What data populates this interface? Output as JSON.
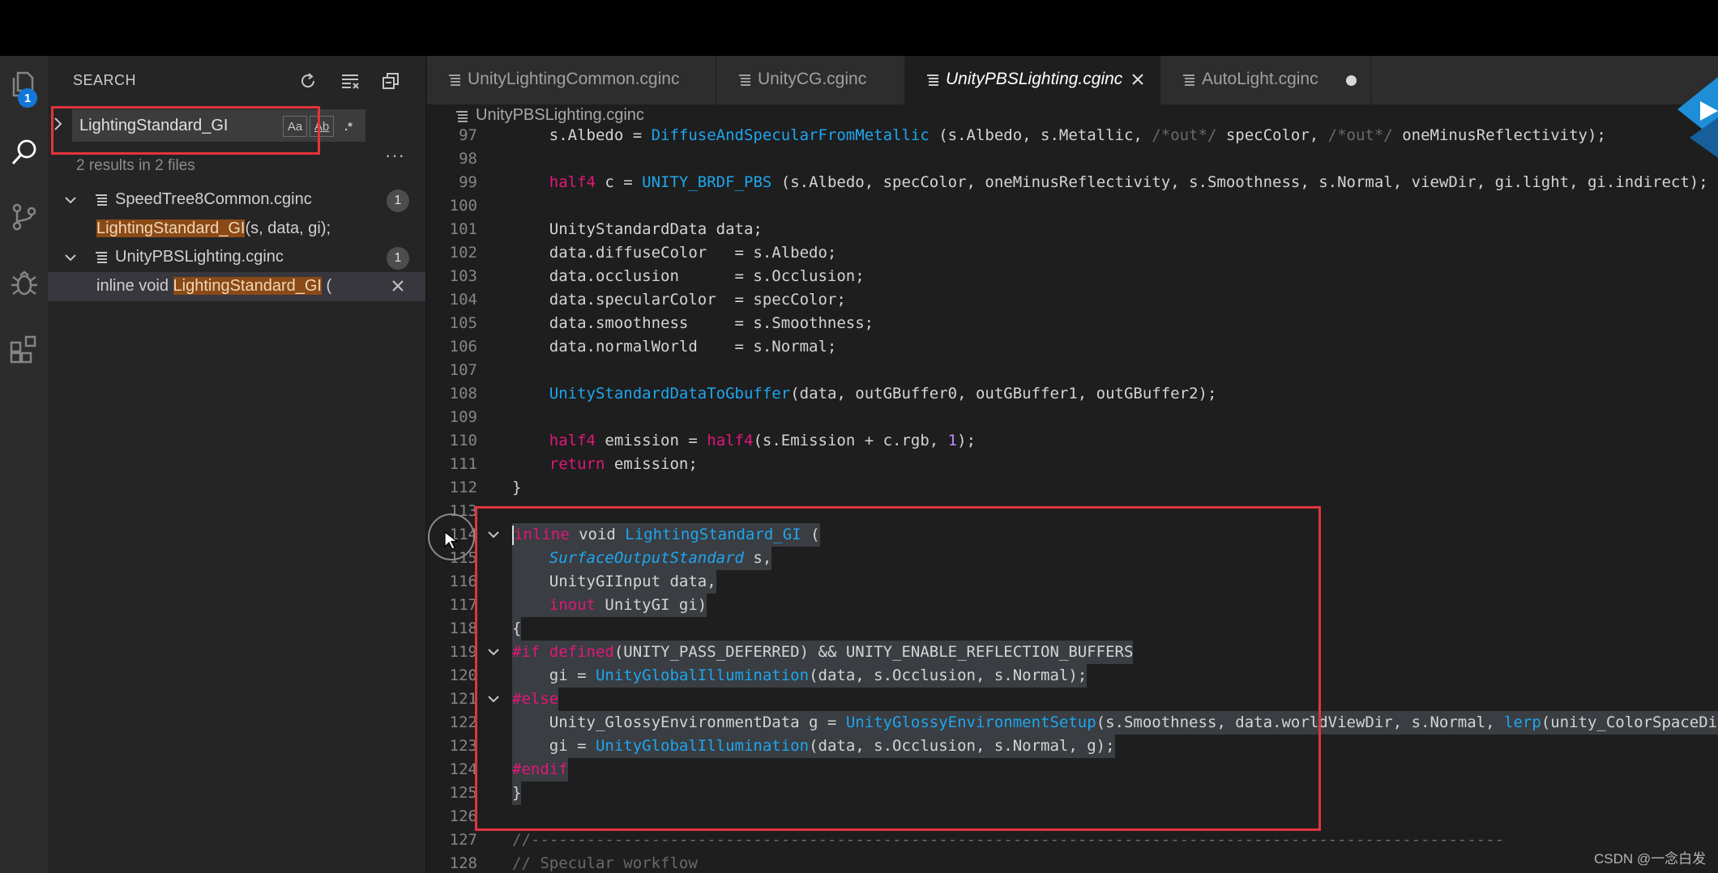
{
  "search": {
    "title": "SEARCH",
    "query": "LightingStandard_GI",
    "match_case_label": "Aa",
    "whole_word_label": "Ab",
    "regex_label": ".*",
    "more_label": "···",
    "summary": "2 results in 2 files",
    "results": [
      {
        "file": "SpeedTree8Common.cginc",
        "count": "1",
        "match": {
          "before": "",
          "hit": "LightingStandard_GI",
          "after": "(s, data, gi);"
        }
      },
      {
        "file": "UnityPBSLighting.cginc",
        "count": "1",
        "match": {
          "before": "inline void ",
          "hit": "LightingStandard_GI",
          "after": " ("
        }
      }
    ]
  },
  "activity_bar": {
    "badge": "1",
    "icons": [
      "files-icon",
      "search-icon",
      "source-control-icon",
      "debug-icon",
      "extensions-icon"
    ]
  },
  "tabs": [
    {
      "label": "UnityLightingCommon.cginc",
      "active": false
    },
    {
      "label": "UnityCG.cginc",
      "active": false
    },
    {
      "label": "UnityPBSLighting.cginc",
      "active": true
    },
    {
      "label": "AutoLight.cginc",
      "active": false,
      "modified": true
    }
  ],
  "breadcrumb": {
    "file": "UnityPBSLighting.cginc"
  },
  "code_lines": [
    {
      "n": "97",
      "segs": [
        [
          "    s.Albedo = ",
          ""
        ],
        [
          "DiffuseAndSpecularFromMetallic",
          "fn"
        ],
        [
          " (s.Albedo, s.Metallic, ",
          ""
        ],
        [
          "/*out*/",
          "cm"
        ],
        [
          " specColor, ",
          ""
        ],
        [
          "/*out*/",
          "cm"
        ],
        [
          " oneMinusReflectivity);",
          ""
        ]
      ]
    },
    {
      "n": "98",
      "segs": []
    },
    {
      "n": "99",
      "segs": [
        [
          "    ",
          ""
        ],
        [
          "half4",
          "kw"
        ],
        [
          " c = ",
          ""
        ],
        [
          "UNITY_BRDF_PBS",
          "fn"
        ],
        [
          " (s.Albedo, specColor, oneMinusReflectivity, s.Smoothness, s.Normal, viewDir, gi.light, gi.indirect);",
          ""
        ]
      ]
    },
    {
      "n": "100",
      "segs": []
    },
    {
      "n": "101",
      "segs": [
        [
          "    UnityStandardData data;",
          ""
        ]
      ]
    },
    {
      "n": "102",
      "segs": [
        [
          "    data.diffuseColor   = s.Albedo;",
          ""
        ]
      ]
    },
    {
      "n": "103",
      "segs": [
        [
          "    data.occlusion      = s.Occlusion;",
          ""
        ]
      ]
    },
    {
      "n": "104",
      "segs": [
        [
          "    data.specularColor  = specColor;",
          ""
        ]
      ]
    },
    {
      "n": "105",
      "segs": [
        [
          "    data.smoothness     = s.Smoothness;",
          ""
        ]
      ]
    },
    {
      "n": "106",
      "segs": [
        [
          "    data.normalWorld    = s.Normal;",
          ""
        ]
      ]
    },
    {
      "n": "107",
      "segs": []
    },
    {
      "n": "108",
      "segs": [
        [
          "    ",
          ""
        ],
        [
          "UnityStandardDataToGbuffer",
          "fn"
        ],
        [
          "(data, outGBuffer0, outGBuffer1, outGBuffer2);",
          ""
        ]
      ]
    },
    {
      "n": "109",
      "segs": []
    },
    {
      "n": "110",
      "segs": [
        [
          "    ",
          ""
        ],
        [
          "half4",
          "kw"
        ],
        [
          " emission = ",
          ""
        ],
        [
          "half4",
          "kw"
        ],
        [
          "(s.Emission + c.rgb, ",
          ""
        ],
        [
          "1",
          "num"
        ],
        [
          ");",
          ""
        ]
      ]
    },
    {
      "n": "111",
      "segs": [
        [
          "    ",
          ""
        ],
        [
          "return",
          "kw"
        ],
        [
          " emission;",
          ""
        ]
      ]
    },
    {
      "n": "112",
      "segs": [
        [
          "}",
          ""
        ]
      ]
    },
    {
      "n": "113",
      "segs": []
    },
    {
      "n": "114",
      "fold": true,
      "sel": true,
      "cursor": true,
      "segs": [
        [
          "inline",
          "kw"
        ],
        [
          " void ",
          ""
        ],
        [
          "LightingStandard_GI",
          "fn"
        ],
        [
          " (",
          ""
        ]
      ]
    },
    {
      "n": "115",
      "sel": true,
      "segs": [
        [
          "    ",
          ""
        ],
        [
          "SurfaceOutputStandard",
          "it"
        ],
        [
          " s,",
          ""
        ]
      ]
    },
    {
      "n": "116",
      "sel": true,
      "segs": [
        [
          "    UnityGIInput data,",
          ""
        ]
      ]
    },
    {
      "n": "117",
      "sel": true,
      "segs": [
        [
          "    ",
          ""
        ],
        [
          "inout",
          "kw"
        ],
        [
          " UnityGI gi)",
          ""
        ]
      ]
    },
    {
      "n": "118",
      "sel": true,
      "segs": [
        [
          "{",
          ""
        ]
      ]
    },
    {
      "n": "119",
      "fold": true,
      "sel": true,
      "segs": [
        [
          "#if defined",
          "kw"
        ],
        [
          "(UNITY_PASS_DEFERRED) && UNITY_ENABLE_REFLECTION_BUFFERS",
          ""
        ]
      ]
    },
    {
      "n": "120",
      "sel": true,
      "segs": [
        [
          "    gi = ",
          ""
        ],
        [
          "UnityGlobalIllumination",
          "fn"
        ],
        [
          "(data, s.Occlusion, s.Normal);",
          ""
        ]
      ]
    },
    {
      "n": "121",
      "fold": true,
      "sel": true,
      "segs": [
        [
          "#else",
          "kw"
        ]
      ]
    },
    {
      "n": "122",
      "sel": true,
      "segs": [
        [
          "    Unity_GlossyEnvironmentData g = ",
          ""
        ],
        [
          "UnityGlossyEnvironmentSetup",
          "fn"
        ],
        [
          "(s.Smoothness, data.worldViewDir, s.Normal, ",
          ""
        ],
        [
          "lerp",
          "fn"
        ],
        [
          "(unity_ColorSpaceDielectricSpec.rgb, s.Albedo, s.Metallic));",
          ""
        ]
      ]
    },
    {
      "n": "123",
      "sel": true,
      "segs": [
        [
          "    gi = ",
          ""
        ],
        [
          "UnityGlobalIllumination",
          "fn"
        ],
        [
          "(data, s.Occlusion, s.Normal, g);",
          ""
        ]
      ]
    },
    {
      "n": "124",
      "sel": true,
      "segs": [
        [
          "#endif",
          "kw"
        ]
      ]
    },
    {
      "n": "125",
      "sel": true,
      "segs": [
        [
          "}",
          ""
        ]
      ]
    },
    {
      "n": "126",
      "segs": []
    },
    {
      "n": "127",
      "segs": [
        [
          "//---------------------------------------------------------------------------------------------------------",
          "cm"
        ]
      ]
    },
    {
      "n": "128",
      "segs": [
        [
          "// Specular workflow",
          "cm"
        ]
      ]
    }
  ],
  "watermark": "CSDN @一念白发",
  "colors": {
    "annotation_red": "#e2343c",
    "keyword": "#e0177b",
    "function": "#1ea6f0",
    "match_highlight": "#8a4a16",
    "accent_blue": "#1177d8"
  }
}
